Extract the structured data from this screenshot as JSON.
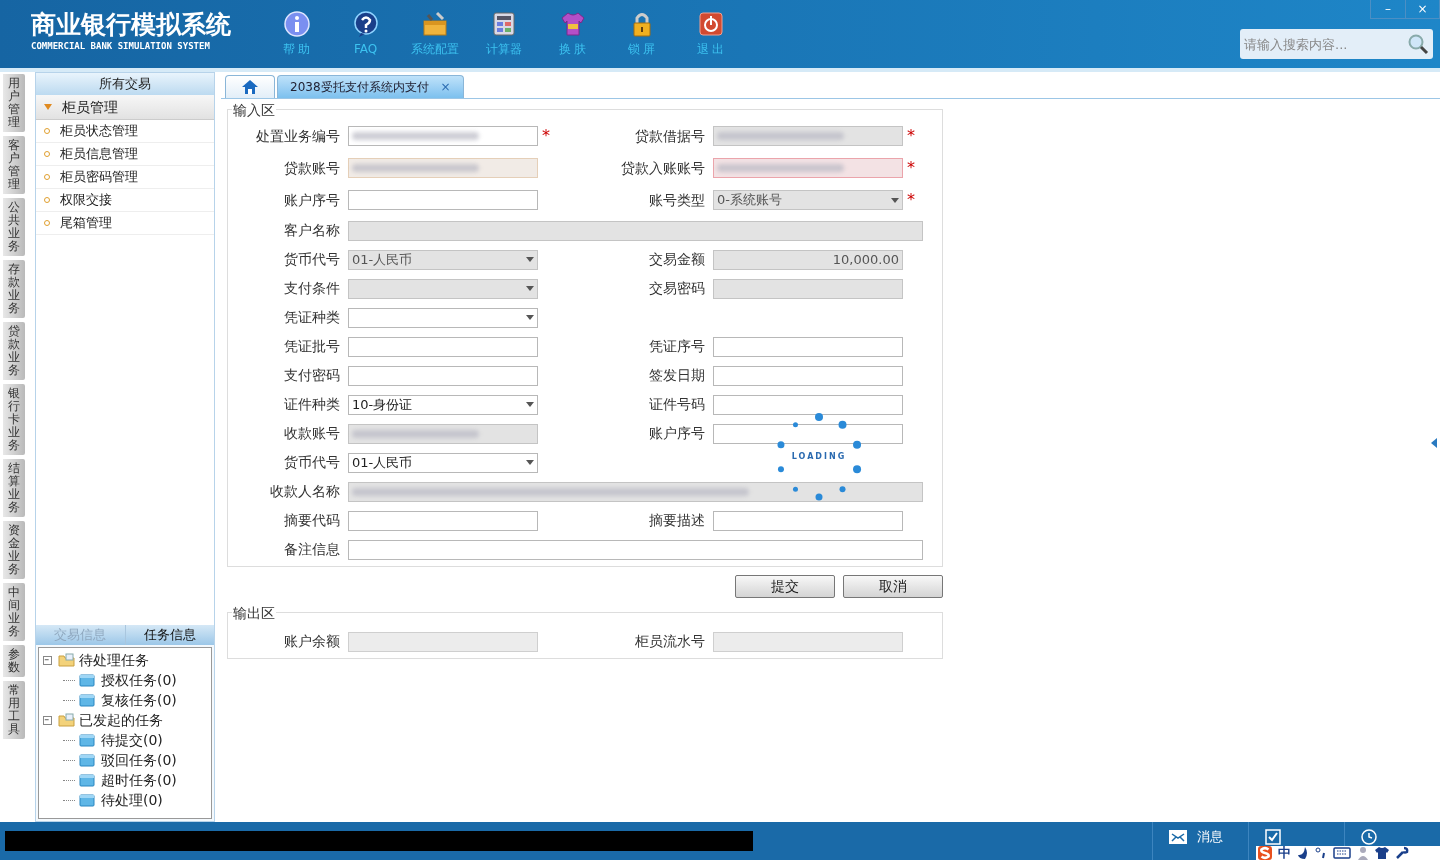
{
  "header": {
    "title": "商业银行模拟系统",
    "subtitle": "COMMERCIAL BANK SIMULATION SYSTEM",
    "tools": [
      {
        "kind": "info",
        "label": "帮 助"
      },
      {
        "kind": "question",
        "label": "FAQ"
      },
      {
        "kind": "toolbox",
        "label": "系统配置"
      },
      {
        "kind": "calculator",
        "label": "计算器"
      },
      {
        "kind": "shirt",
        "label": "换 肤"
      },
      {
        "kind": "lock",
        "label": "锁 屏"
      },
      {
        "kind": "power",
        "label": "退 出"
      }
    ],
    "window_controls": [
      "–",
      "×"
    ],
    "search": {
      "placeholder": "请输入搜索内容..."
    }
  },
  "side_tabs": [
    "用户管理",
    "客户管理",
    "公共业务",
    "存款业务",
    "贷款业务",
    "银行卡业务",
    "结算业务",
    "资金业务",
    "中间业务",
    "参数",
    "常用工具"
  ],
  "menu": {
    "title": "所有交易",
    "group": {
      "label": "柜员管理",
      "expanded": true
    },
    "items": [
      "柜员状态管理",
      "柜员信息管理",
      "柜员密码管理",
      "权限交接",
      "尾箱管理"
    ]
  },
  "task_panel": {
    "tabs": [
      {
        "label": "交易信息",
        "selected": false
      },
      {
        "label": "任务信息",
        "selected": true
      }
    ],
    "tree": [
      {
        "label": "待处理任务",
        "expanded": true,
        "children": [
          {
            "label": "授权任务(0)"
          },
          {
            "label": "复核任务(0)"
          }
        ]
      },
      {
        "label": "已发起的任务",
        "expanded": true,
        "children": [
          {
            "label": "待提交(0)"
          },
          {
            "label": "驳回任务(0)"
          },
          {
            "label": "超时任务(0)"
          },
          {
            "label": "待处理(0)"
          }
        ]
      }
    ]
  },
  "doc_tabs": [
    {
      "kind": "home",
      "selected": false
    },
    {
      "kind": "page",
      "label": "2038受托支付系统内支付",
      "close": "×",
      "selected": true
    }
  ],
  "input_area": {
    "legend": "输入区",
    "rows": [
      {
        "left": {
          "label": "处置业务编号",
          "kind": "input",
          "disabled": false,
          "redacted": true,
          "highlight": false,
          "invalid": false,
          "required_mark": "*"
        },
        "right": {
          "label": "贷款借据号",
          "kind": "input",
          "disabled": true,
          "redacted": true,
          "highlight": false,
          "invalid": false,
          "required_mark": "*"
        }
      },
      {
        "left": {
          "label": "贷款账号",
          "kind": "input",
          "disabled": false,
          "redacted": true,
          "highlight": true,
          "invalid": false
        },
        "right": {
          "label": "贷款入账账号",
          "kind": "input",
          "disabled": false,
          "redacted": true,
          "highlight": false,
          "invalid": true,
          "required_mark": "*"
        }
      },
      {
        "left": {
          "label": "账户序号",
          "kind": "input",
          "disabled": false,
          "redacted": false,
          "highlight": false,
          "invalid": false
        },
        "right": {
          "label": "账号类型",
          "kind": "select",
          "value": "0-系统账号",
          "disabled": true,
          "redacted": false,
          "highlight": false,
          "invalid": false,
          "required_mark": "*"
        }
      },
      {
        "left": {
          "label": "客户名称",
          "kind": "wide",
          "disabled": true,
          "redacted": false,
          "highlight": false,
          "invalid": false
        }
      },
      {
        "left": {
          "label": "货币代号",
          "kind": "select",
          "value": "01-人民币",
          "disabled": true,
          "redacted": false,
          "highlight": false,
          "invalid": false
        },
        "right": {
          "label": "交易金额",
          "kind": "amount",
          "value": "10,000.00",
          "disabled": true,
          "redacted": false,
          "highlight": false,
          "invalid": false
        }
      },
      {
        "left": {
          "label": "支付条件",
          "kind": "select",
          "disabled": true,
          "redacted": false,
          "highlight": false,
          "invalid": false
        },
        "right": {
          "label": "交易密码",
          "kind": "input",
          "disabled": true,
          "redacted": false,
          "highlight": false,
          "invalid": false
        }
      },
      {
        "left": {
          "label": "凭证种类",
          "kind": "select",
          "disabled": false,
          "redacted": false,
          "highlight": false,
          "invalid": false
        }
      },
      {
        "left": {
          "label": "凭证批号",
          "kind": "input",
          "disabled": false,
          "redacted": false,
          "highlight": false,
          "invalid": false
        },
        "right": {
          "label": "凭证序号",
          "kind": "input",
          "disabled": false,
          "redacted": false,
          "highlight": false,
          "invalid": false
        }
      },
      {
        "left": {
          "label": "支付密码",
          "kind": "input",
          "disabled": false,
          "redacted": false,
          "highlight": false,
          "invalid": false
        },
        "right": {
          "label": "签发日期",
          "kind": "input",
          "disabled": false,
          "redacted": false,
          "highlight": false,
          "invalid": false
        }
      },
      {
        "left": {
          "label": "证件种类",
          "kind": "select",
          "value": "10-身份证",
          "disabled": false,
          "redacted": false,
          "highlight": false,
          "invalid": false
        },
        "right": {
          "label": "证件号码",
          "kind": "input",
          "disabled": false,
          "redacted": false,
          "highlight": false,
          "invalid": false
        }
      },
      {
        "left": {
          "label": "收款账号",
          "kind": "input",
          "disabled": true,
          "redacted": true,
          "highlight": false,
          "invalid": false
        },
        "right": {
          "label": "账户序号",
          "kind": "input",
          "disabled": false,
          "redacted": false,
          "highlight": false,
          "invalid": false
        }
      },
      {
        "left": {
          "label": "货币代号",
          "kind": "select",
          "value": "01-人民币",
          "disabled": false,
          "redacted": false,
          "highlight": false,
          "invalid": false
        }
      },
      {
        "left": {
          "label": "收款人名称",
          "kind": "wide",
          "disabled": true,
          "redacted": true,
          "highlight": false,
          "invalid": false
        }
      },
      {
        "left": {
          "label": "摘要代码",
          "kind": "input",
          "disabled": false,
          "redacted": false,
          "highlight": false,
          "invalid": false
        },
        "right": {
          "label": "摘要描述",
          "kind": "input",
          "disabled": false,
          "redacted": false,
          "highlight": false,
          "invalid": false
        }
      },
      {
        "left": {
          "label": "备注信息",
          "kind": "wide",
          "disabled": false,
          "redacted": false,
          "highlight": false,
          "invalid": false
        }
      }
    ]
  },
  "buttons": [
    "提交",
    "取消"
  ],
  "output_area": {
    "legend": "输出区",
    "fields": [
      {
        "label": "账户余额"
      },
      {
        "label": "柜员流水号"
      }
    ]
  },
  "loading": {
    "text": "LOADING"
  },
  "status_bar": {
    "items": [
      {
        "kind": "mail",
        "label": "消息"
      },
      {
        "kind": "check"
      },
      {
        "kind": "clock"
      }
    ]
  },
  "ime_bar": {
    "mode": "中"
  }
}
